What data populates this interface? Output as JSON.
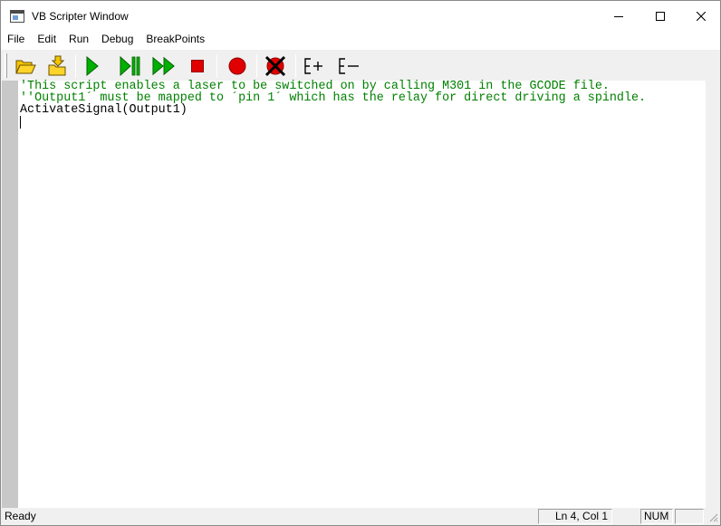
{
  "window": {
    "title": "VB Scripter Window",
    "icons": {
      "app": "window-app-icon",
      "minimize": "minimize-icon",
      "maximize": "maximize-icon",
      "close": "close-icon"
    }
  },
  "menu": {
    "items": [
      {
        "label": "File"
      },
      {
        "label": "Edit"
      },
      {
        "label": "Run"
      },
      {
        "label": "Debug"
      },
      {
        "label": "BreakPoints"
      }
    ]
  },
  "toolbar": {
    "buttons": [
      {
        "name": "open-button",
        "icon": "open-folder-icon"
      },
      {
        "name": "save-button",
        "icon": "save-folder-icon"
      },
      {
        "name": "run-button",
        "icon": "play-icon"
      },
      {
        "name": "step-button",
        "icon": "step-icon"
      },
      {
        "name": "run-to-end-button",
        "icon": "fast-forward-icon"
      },
      {
        "name": "stop-button",
        "icon": "stop-icon"
      },
      {
        "name": "toggle-breakpoint-button",
        "icon": "breakpoint-icon"
      },
      {
        "name": "clear-breakpoints-button",
        "icon": "clear-breakpoint-icon"
      },
      {
        "name": "expand-button",
        "icon": "e-plus-icon",
        "label": "E+"
      },
      {
        "name": "collapse-button",
        "icon": "e-minus-icon",
        "label": "E−"
      }
    ],
    "colors": {
      "green": "#00b000",
      "red": "#e00000",
      "folder": "#f5c400"
    }
  },
  "editor": {
    "lines": [
      {
        "text": "'This script enables a laser to be switched on by calling M301 in the GCODE file.",
        "kind": "comment"
      },
      {
        "text": "''Output1´ must be mapped to ´pin 1´ which has the relay for direct driving a spindle.",
        "kind": "comment"
      },
      {
        "text": "ActivateSignal(Output1)",
        "kind": "normal"
      },
      {
        "text": "",
        "kind": "normal"
      }
    ],
    "colors": {
      "comment": "#008000",
      "normal": "#000000"
    }
  },
  "statusbar": {
    "status": "Ready",
    "position": "Ln 4, Col 1",
    "num": "NUM"
  }
}
